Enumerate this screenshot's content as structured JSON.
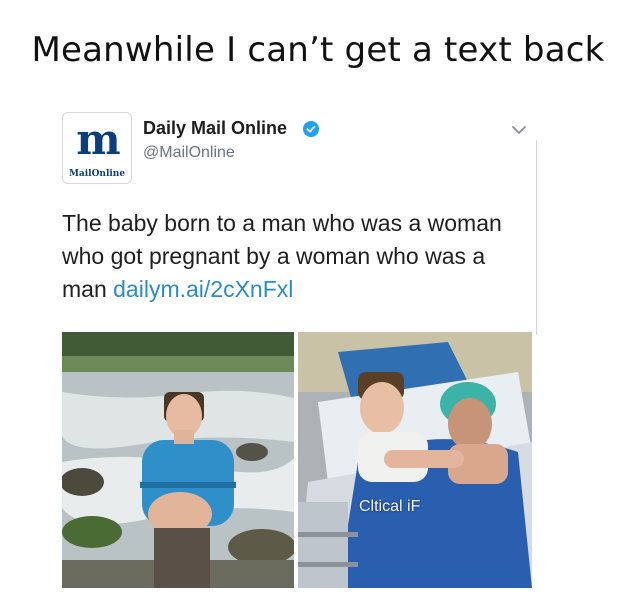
{
  "meme": {
    "caption": "Meanwhile I can’t get  a text back"
  },
  "tweet": {
    "avatar_mark": "m",
    "avatar_sub": "MailOnline",
    "display_name": "Daily Mail Online",
    "handle": "@MailOnline",
    "text": "The baby born to a man who was a woman who got pregnant by a woman who was a man ",
    "link": "dailym.ai/2cXnFxl",
    "watermark": "Cltical iF",
    "icons": {
      "verified": "verified-badge-icon",
      "menu": "chevron-down-icon"
    }
  },
  "colors": {
    "link": "#2b8bd1",
    "verified": "#1da1f2",
    "brand": "#0b3f7c"
  }
}
